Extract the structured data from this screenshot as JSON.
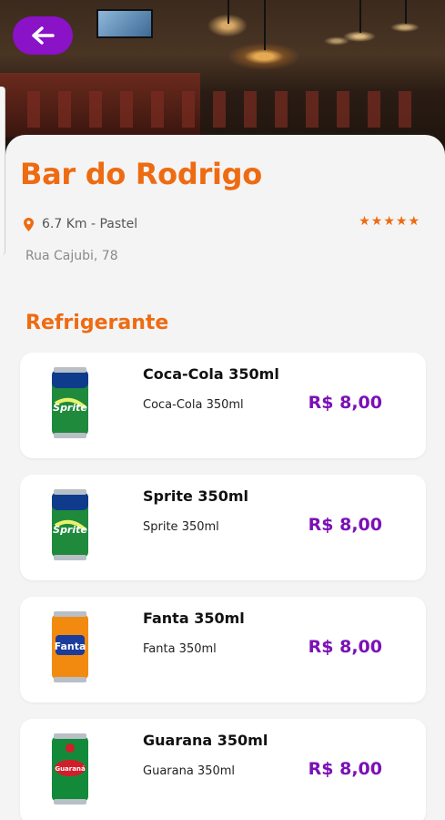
{
  "header": {
    "back_icon": "arrow-left-icon",
    "accent": "#8a12c7"
  },
  "restaurant": {
    "name": "Bar do Rodrigo",
    "distance_category": "6.7 Km - Pastel",
    "rating": 5,
    "address": "Rua Cajubi, 78",
    "accent": "#ee6b12"
  },
  "menu": {
    "section_title": "Refrigerante",
    "items": [
      {
        "name": "Coca-Cola 350ml",
        "description": "Coca-Cola 350ml",
        "price": "R$ 8,00",
        "can": "sprite"
      },
      {
        "name": "Sprite 350ml",
        "description": "Sprite 350ml",
        "price": "R$ 8,00",
        "can": "sprite"
      },
      {
        "name": "Fanta 350ml",
        "description": "Fanta 350ml",
        "price": "R$ 8,00",
        "can": "fanta"
      },
      {
        "name": "Guarana 350ml",
        "description": "Guarana 350ml",
        "price": "R$ 8,00",
        "can": "guarana"
      }
    ],
    "price_color": "#7b10b6"
  }
}
